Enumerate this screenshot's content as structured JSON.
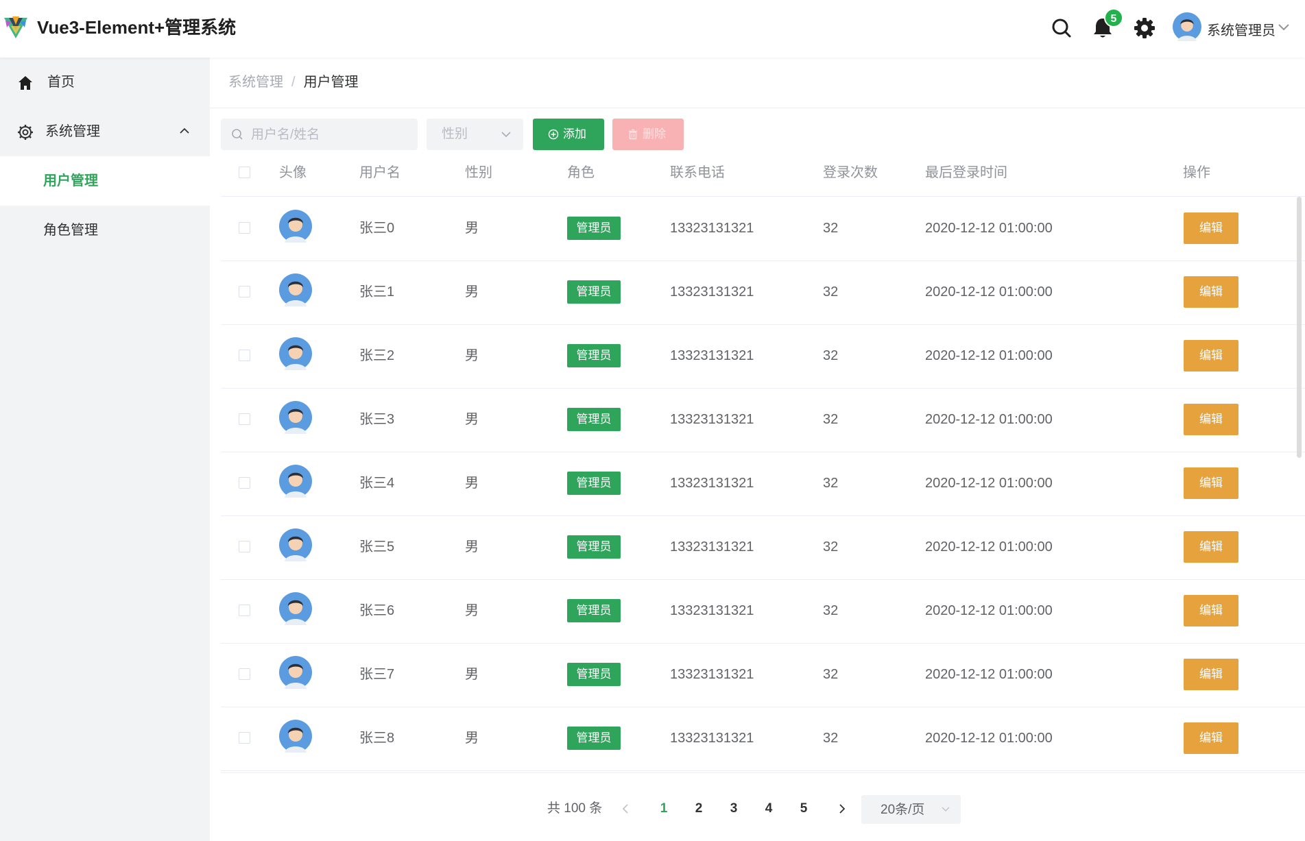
{
  "app": {
    "title": "Vue3-Element+管理系统"
  },
  "header": {
    "notification_count": "5",
    "user_name": "系统管理员",
    "icons": [
      "search-icon",
      "bell-icon",
      "gear-icon",
      "avatar",
      "chevron-down-icon"
    ]
  },
  "sidebar": {
    "items": [
      {
        "label": "首页",
        "icon": "home-icon"
      },
      {
        "label": "系统管理",
        "icon": "gear-icon",
        "expanded": true
      }
    ],
    "subitems": [
      {
        "label": "用户管理",
        "active": true
      },
      {
        "label": "角色管理",
        "active": false
      }
    ]
  },
  "breadcrumb": {
    "parent": "系统管理",
    "separator": "/",
    "current": "用户管理"
  },
  "toolbar": {
    "search_placeholder": "用户名/姓名",
    "gender_placeholder": "性别",
    "add_label": "添加",
    "delete_label": "删除"
  },
  "table": {
    "columns": [
      "头像",
      "用户名",
      "性别",
      "角色",
      "联系电话",
      "登录次数",
      "最后登录时间",
      "操作"
    ],
    "edit_label": "编辑",
    "rows": [
      {
        "username": "张三0",
        "gender": "男",
        "role": "管理员",
        "phone": "13323131321",
        "login_count": "32",
        "last_login": "2020-12-12 01:00:00"
      },
      {
        "username": "张三1",
        "gender": "男",
        "role": "管理员",
        "phone": "13323131321",
        "login_count": "32",
        "last_login": "2020-12-12 01:00:00"
      },
      {
        "username": "张三2",
        "gender": "男",
        "role": "管理员",
        "phone": "13323131321",
        "login_count": "32",
        "last_login": "2020-12-12 01:00:00"
      },
      {
        "username": "张三3",
        "gender": "男",
        "role": "管理员",
        "phone": "13323131321",
        "login_count": "32",
        "last_login": "2020-12-12 01:00:00"
      },
      {
        "username": "张三4",
        "gender": "男",
        "role": "管理员",
        "phone": "13323131321",
        "login_count": "32",
        "last_login": "2020-12-12 01:00:00"
      },
      {
        "username": "张三5",
        "gender": "男",
        "role": "管理员",
        "phone": "13323131321",
        "login_count": "32",
        "last_login": "2020-12-12 01:00:00"
      },
      {
        "username": "张三6",
        "gender": "男",
        "role": "管理员",
        "phone": "13323131321",
        "login_count": "32",
        "last_login": "2020-12-12 01:00:00"
      },
      {
        "username": "张三7",
        "gender": "男",
        "role": "管理员",
        "phone": "13323131321",
        "login_count": "32",
        "last_login": "2020-12-12 01:00:00"
      },
      {
        "username": "张三8",
        "gender": "男",
        "role": "管理员",
        "phone": "13323131321",
        "login_count": "32",
        "last_login": "2020-12-12 01:00:00"
      }
    ]
  },
  "pagination": {
    "total_label": "共 100 条",
    "pages": [
      "1",
      "2",
      "3",
      "4",
      "5"
    ],
    "current_page": "1",
    "page_size": "20条/页"
  },
  "colors": {
    "primary": "#2fa55c",
    "warning": "#e6a23c",
    "danger_light": "#f9b2b4",
    "sidebar_bg": "#f2f3f5"
  }
}
